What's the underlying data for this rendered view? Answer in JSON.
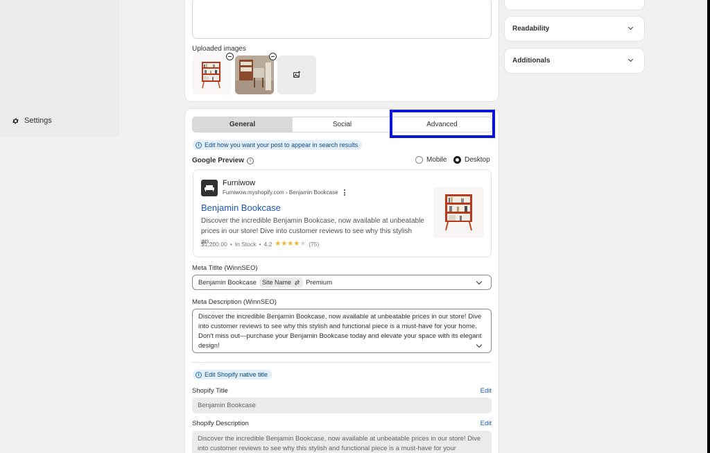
{
  "colors": {
    "highlight": "#0a16d6",
    "link": "#1a55c4",
    "star": "#f3b425"
  },
  "sidebar": {
    "settings_label": "Settings",
    "settings_icon": "gear-icon"
  },
  "uploads": {
    "label": "Uploaded images",
    "add_icon": "add-image-icon"
  },
  "tabs": [
    {
      "label": "General",
      "active": true
    },
    {
      "label": "Social",
      "active": false
    },
    {
      "label": "Advanced",
      "active": false
    }
  ],
  "info_banner": "Edit how you want your post to appear in search results",
  "google_preview": {
    "label": "Google Preview",
    "device_options": [
      "Mobile",
      "Desktop"
    ],
    "selected_device": "Desktop",
    "site_name": "Furniwow",
    "site_url": "Furniwow.myshopify.com › Benjamin Bookcase",
    "result_title": "Benjamin Bookcase",
    "result_description": "Discover the incredible Benjamin Bookcase, now available at unbeatable prices in our store! Dive into customer reviews to see why this stylish an...",
    "price": "$1,200.00",
    "stock": "In Stock",
    "rating": "4.2",
    "rating_count": "(75)",
    "stars_filled": 4
  },
  "meta_title": {
    "label": "Meta Titlte (WinnSEO)",
    "value_prefix": "Benjamin Bookcase",
    "chip": "Site Name",
    "value_suffix": "Premium"
  },
  "meta_description": {
    "label": "Meta Description (WinnSEO)",
    "value": "Discover the incredible Benjamin Bookcase, now available at unbeatable prices in our store! Dive into customer reviews to see why this stylish and functional piece is a must-have for your home. Don't miss out—purchase your Benjamin Bookcase today and elevate your space with its elegant design!"
  },
  "shopify": {
    "banner": "Edit Shopify native title",
    "title_label": "Shopify Title",
    "title_value": "Benjamin Bookcase",
    "description_label": "Shopify Description",
    "description_value": "Discover the incredible Benjamin Bookcase, now available at unbeatable prices in our store! Dive into customer reviews to see why this stylish and functional piece is a must-have for your",
    "edit_label": "Edit"
  },
  "right_panel": [
    {
      "label": "Readability"
    },
    {
      "label": "Additionals"
    }
  ]
}
